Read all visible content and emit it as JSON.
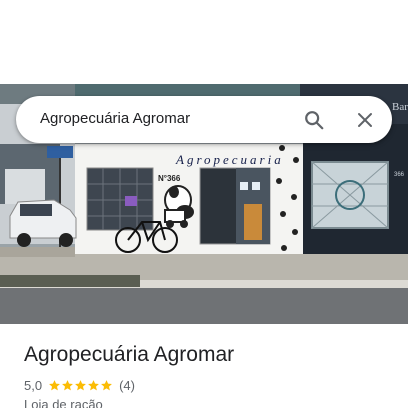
{
  "search": {
    "query": "Agropecuária Agromar"
  },
  "storefront": {
    "sign_text": "Agropecuaria",
    "number_text": "N°366",
    "neighbor_sign": "Bar",
    "neighbor_number": "366"
  },
  "place": {
    "name": "Agropecuária Agromar",
    "rating": "5,0",
    "star_count": 5,
    "review_count": "(4)",
    "category": "Loja de ração"
  },
  "colors": {
    "star": "#fbbc04",
    "text_primary": "#202124",
    "text_secondary": "#5f6368"
  }
}
